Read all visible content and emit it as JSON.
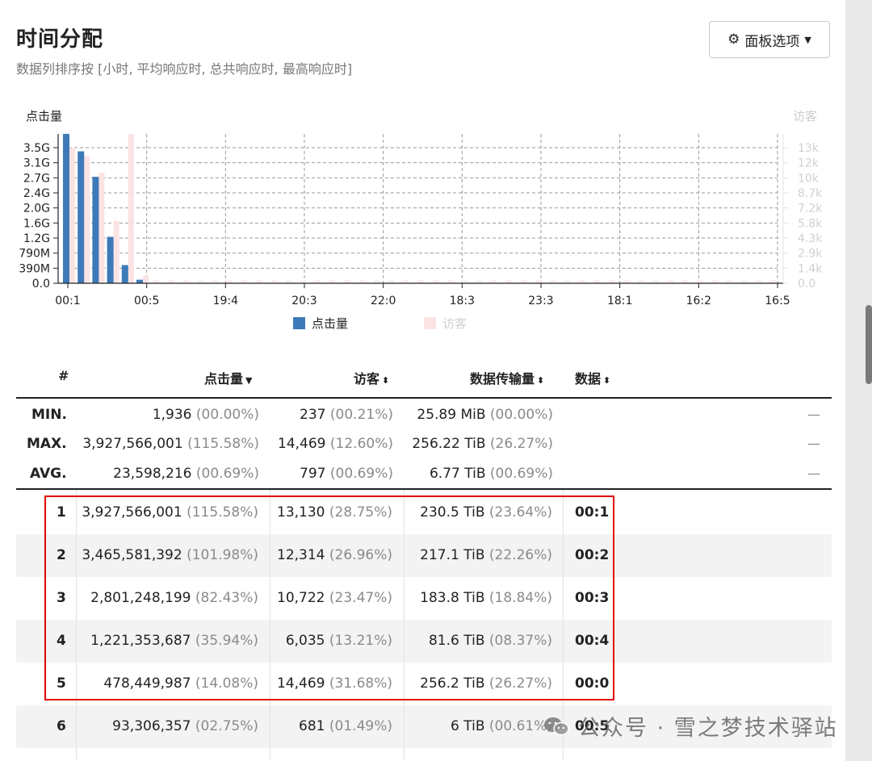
{
  "header": {
    "title": "时间分配",
    "subtitle": "数据列排序按 [小时, 平均响应时, 总共响应时, 最高响应时]",
    "options_button": "面板选项"
  },
  "chart_data": {
    "type": "bar",
    "y_left_label": "点击量",
    "y_right_label": "访客",
    "left_ticks": [
      "0.0",
      "390M",
      "790M",
      "1.2G",
      "1.6G",
      "2.0G",
      "2.4G",
      "2.7G",
      "3.1G",
      "3.5G"
    ],
    "right_ticks": [
      "0.0",
      "1.4k",
      "2.9k",
      "4.3k",
      "5.8k",
      "7.2k",
      "8.7k",
      "10k",
      "12k",
      "13k"
    ],
    "x_ticks": [
      "00:1",
      "00:5",
      "19:4",
      "20:3",
      "22:0",
      "18:3",
      "23:3",
      "18:1",
      "16:2",
      "16:5"
    ],
    "left_max": 3.927566,
    "right_max": 14.469,
    "hits_g": [
      3.93,
      3.47,
      2.8,
      1.22,
      0.478,
      0.093
    ],
    "visitors_k": [
      13.13,
      12.31,
      10.72,
      6.035,
      14.47,
      0.681
    ],
    "legend": [
      "点击量",
      "访客"
    ],
    "colors": {
      "hits": "#3d7ab8",
      "visitors": "#fbe3e3"
    }
  },
  "table": {
    "headers": {
      "num": "#",
      "hits": "点击量",
      "visitors": "访客",
      "bandwidth": "数据传输量",
      "data": "数据"
    },
    "summary": [
      {
        "label": "MIN.",
        "hits": "1,936",
        "hits_pct": "(00.00%)",
        "visitors": "237",
        "visitors_pct": "(00.21%)",
        "bw": "25.89 MiB",
        "bw_pct": "(00.00%)",
        "dash": "—"
      },
      {
        "label": "MAX.",
        "hits": "3,927,566,001",
        "hits_pct": "(115.58%)",
        "visitors": "14,469",
        "visitors_pct": "(12.60%)",
        "bw": "256.22 TiB",
        "bw_pct": "(26.27%)",
        "dash": "—"
      },
      {
        "label": "AVG.",
        "hits": "23,598,216",
        "hits_pct": "(00.69%)",
        "visitors": "797",
        "visitors_pct": "(00.69%)",
        "bw": "6.77 TiB",
        "bw_pct": "(00.69%)",
        "dash": "—"
      }
    ],
    "rows": [
      {
        "num": "1",
        "hits": "3,927,566,001",
        "hits_pct": "(115.58%)",
        "visitors": "13,130",
        "visitors_pct": "(28.75%)",
        "bw": "230.5 TiB",
        "bw_pct": "(23.64%)",
        "data": "00:1"
      },
      {
        "num": "2",
        "hits": "3,465,581,392",
        "hits_pct": "(101.98%)",
        "visitors": "12,314",
        "visitors_pct": "(26.96%)",
        "bw": "217.1 TiB",
        "bw_pct": "(22.26%)",
        "data": "00:2"
      },
      {
        "num": "3",
        "hits": "2,801,248,199",
        "hits_pct": "(82.43%)",
        "visitors": "10,722",
        "visitors_pct": "(23.47%)",
        "bw": "183.8 TiB",
        "bw_pct": "(18.84%)",
        "data": "00:3"
      },
      {
        "num": "4",
        "hits": "1,221,353,687",
        "hits_pct": "(35.94%)",
        "visitors": "6,035",
        "visitors_pct": "(13.21%)",
        "bw": "81.6 TiB",
        "bw_pct": "(08.37%)",
        "data": "00:4"
      },
      {
        "num": "5",
        "hits": "478,449,987",
        "hits_pct": "(14.08%)",
        "visitors": "14,469",
        "visitors_pct": "(31.68%)",
        "bw": "256.2 TiB",
        "bw_pct": "(26.27%)",
        "data": "00:0"
      },
      {
        "num": "6",
        "hits": "93,306,357",
        "hits_pct": "(02.75%)",
        "visitors": "681",
        "visitors_pct": "(01.49%)",
        "bw": "6 TiB",
        "bw_pct": "(00.61%)",
        "data": "00:5"
      }
    ]
  },
  "watermark": "公众号 · 雪之梦技术驿站"
}
